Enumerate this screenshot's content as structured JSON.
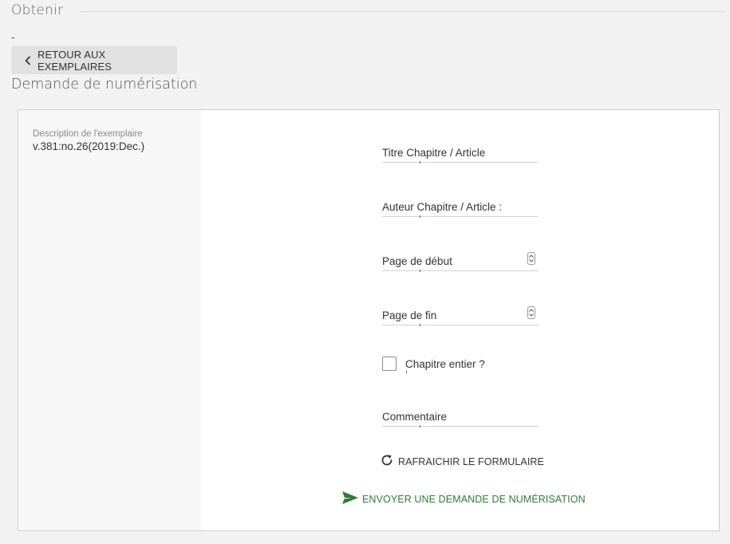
{
  "section": {
    "title": "Obtenir",
    "dash": "-"
  },
  "back_button": {
    "label": "RETOUR AUX EXEMPLAIRES",
    "icon": "chevron-left-icon"
  },
  "page_heading": "Demande de numérisation",
  "item": {
    "description_label": "Description de l'exemplaire",
    "description_value": "v.381:no.26(2019:Dec.)"
  },
  "form": {
    "fields": [
      {
        "label": "Titre Chapitre / Article",
        "type": "text"
      },
      {
        "label": "Auteur Chapitre / Article :",
        "type": "text"
      },
      {
        "label": "Page de début",
        "type": "number"
      },
      {
        "label": "Page de fin",
        "type": "number"
      }
    ],
    "checkbox": {
      "label": "Chapitre entier ?",
      "checked": false
    },
    "comment": {
      "label": "Commentaire",
      "type": "text"
    },
    "refresh_button": {
      "label": "RAFRAICHIR LE FORMULAIRE",
      "icon": "refresh-icon"
    },
    "submit_button": {
      "label": "ENVOYER UNE DEMANDE DE NUMÉRISATION",
      "icon": "send-icon"
    }
  },
  "colors": {
    "accent": "#2e7d32",
    "background": "#f2f2f2",
    "button_bg": "#e1e1e1"
  }
}
